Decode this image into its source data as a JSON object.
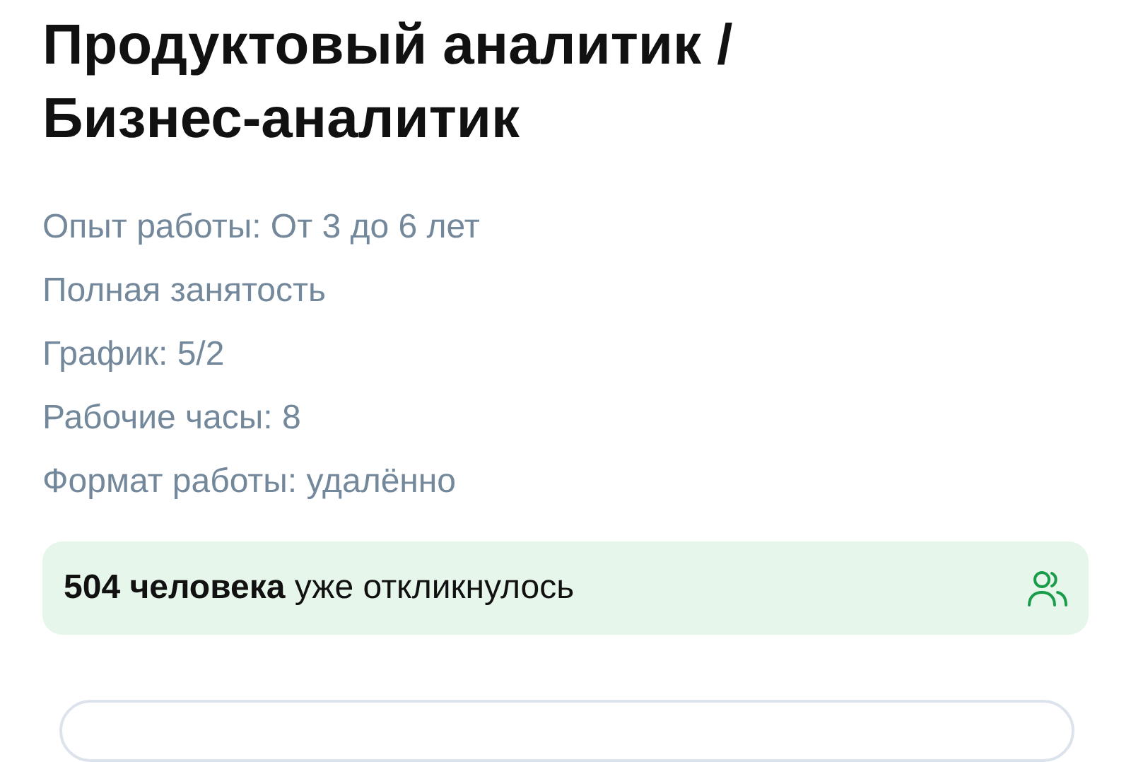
{
  "title": "Продуктовый аналитик / Бизнес-аналитик",
  "details": [
    "Опыт работы: От 3 до 6 лет",
    "Полная занятость",
    "График: 5/2",
    "Рабочие часы: 8",
    "Формат работы: удалённо"
  ],
  "responses": {
    "text": "**504 человека** уже откликнулось"
  }
}
